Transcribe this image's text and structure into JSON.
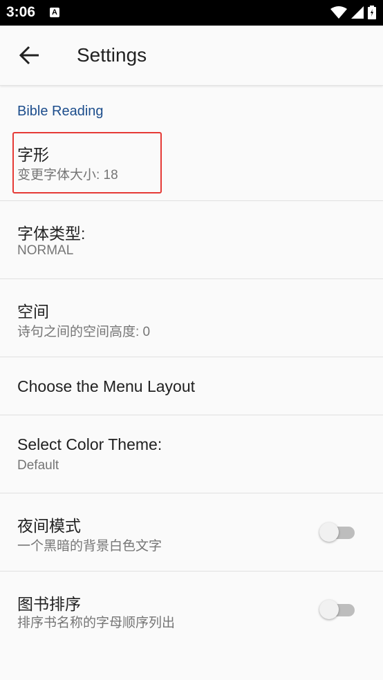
{
  "status_bar": {
    "time": "3:06",
    "notification_icon_label": "A",
    "icons": [
      "wifi-icon",
      "signal-icon",
      "battery-icon"
    ]
  },
  "app_bar": {
    "back_icon": "arrow-back-icon",
    "title": "Settings"
  },
  "category": {
    "title": "Bible Reading"
  },
  "preferences": [
    {
      "title": "字形",
      "summary": "变更字体大小: 18"
    },
    {
      "title": "字体类型:",
      "summary": "NORMAL"
    },
    {
      "title": "空间",
      "summary": "诗句之间的空间高度: 0"
    },
    {
      "title": "Choose the Menu Layout"
    },
    {
      "title": "Select Color Theme:",
      "summary": "Default"
    },
    {
      "title": "夜间模式",
      "summary": "一个黑暗的背景白色文字",
      "switch_on": false
    },
    {
      "title": "图书排序",
      "summary": "排序书名称的字母顺序列出",
      "switch_on": false
    }
  ],
  "colors": {
    "accent": "#1c4d8c",
    "highlight_border": "#e53935",
    "switch_off_track": "#bdbdbd"
  }
}
